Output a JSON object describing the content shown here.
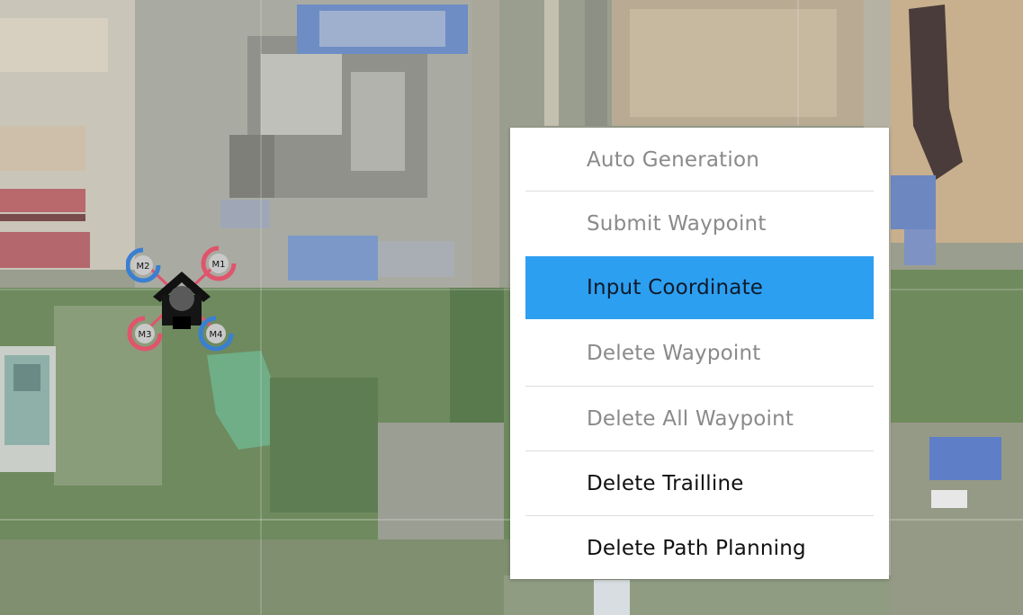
{
  "map": {
    "type": "satellite",
    "markers": [
      {
        "label": "M2",
        "color": "#3a7fd1"
      },
      {
        "label": "M1",
        "color": "#e0546c"
      },
      {
        "label": "M3",
        "color": "#e0546c"
      },
      {
        "label": "M4",
        "color": "#3a7fd1"
      }
    ],
    "drone_icon": "drone-icon"
  },
  "context_menu": {
    "items": [
      {
        "label": "Auto Generation",
        "state": "disabled"
      },
      {
        "label": "Submit Waypoint",
        "state": "disabled"
      },
      {
        "label": "Input Coordinate",
        "state": "highlighted"
      },
      {
        "label": "Delete Waypoint",
        "state": "disabled"
      },
      {
        "label": "Delete All Waypoint",
        "state": "disabled"
      },
      {
        "label": "Delete Trailline",
        "state": "enabled"
      },
      {
        "label": "Delete Path Planning",
        "state": "enabled"
      }
    ],
    "highlight_color": "#2d9ff0"
  }
}
